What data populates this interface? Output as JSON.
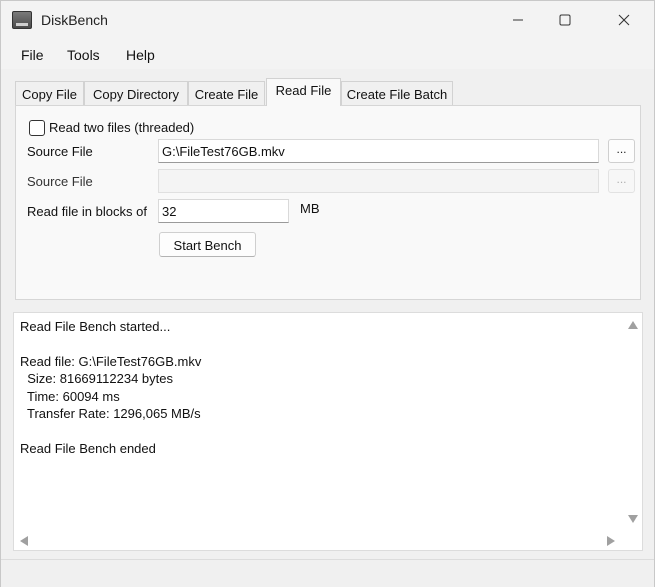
{
  "window": {
    "title": "DiskBench"
  },
  "menu": {
    "items": [
      "File",
      "Tools",
      "Help"
    ]
  },
  "tabs": [
    "Copy File",
    "Copy Directory",
    "Create File",
    "Read File",
    "Create File Batch"
  ],
  "active_tab": "Read File",
  "read_file": {
    "two_files_label": "Read two files (threaded)",
    "two_files_checked": false,
    "source_label_1": "Source File",
    "source_value_1": "G:\\FileTest76GB.mkv",
    "source_label_2": "Source File",
    "source_value_2": "",
    "blocks_label": "Read file in blocks of",
    "blocks_value": "32",
    "blocks_unit": "MB",
    "browse_label": "...",
    "start_button": "Start Bench"
  },
  "log": {
    "lines": [
      "Read File Bench started...",
      "",
      "Read file: G:\\FileTest76GB.mkv",
      "  Size: 81669112234 bytes",
      "  Time: 60094 ms",
      "  Transfer Rate: 1296,065 MB/s",
      "",
      "Read File Bench ended"
    ]
  }
}
